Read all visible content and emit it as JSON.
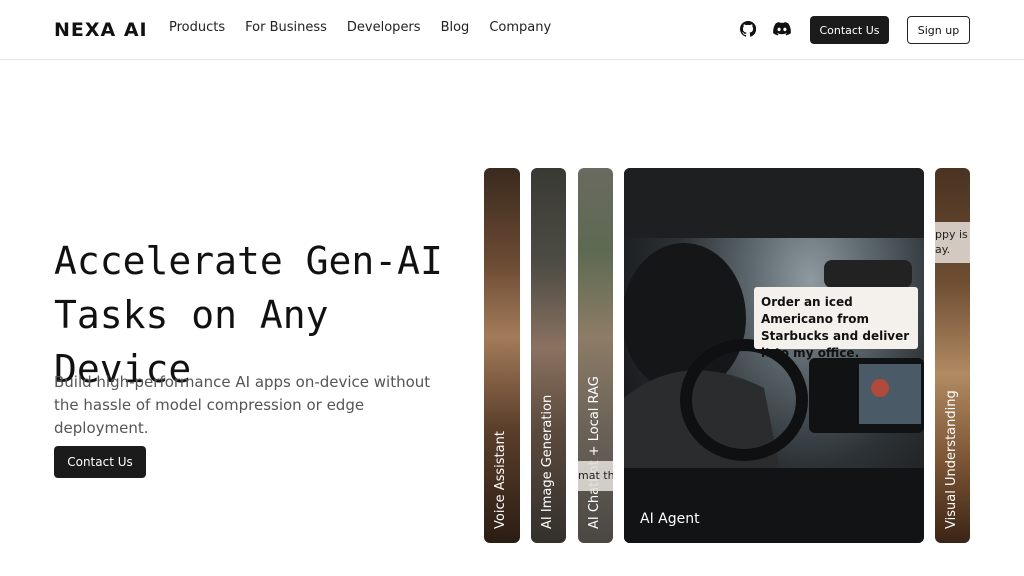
{
  "header": {
    "logo_text": "NEXA AI",
    "nav": [
      "Products",
      "For Business",
      "Developers",
      "Blog",
      "Company"
    ],
    "icons": [
      "github-icon",
      "discord-icon"
    ],
    "contact_label": "Contact Us",
    "signup_label": "Sign up"
  },
  "hero": {
    "title_line1": "Accelerate Gen-AI",
    "title_line2": "Tasks on Any Device",
    "subtitle": "Build high-performance AI apps on-device without the hassle of model compression or edge deployment.",
    "cta_label": "Contact Us"
  },
  "cards": {
    "voice": "Voice Assistant",
    "image_gen": "AI Image Generation",
    "rag": "AI Chatbot + Local RAG",
    "agent": "AI Agent",
    "visual": "Visual Understanding",
    "agent_bubble": "Order an iced Americano from Starbucks and deliver it to my office.",
    "peek_right": "ppy is\nay.",
    "peek_mid": "mat th"
  },
  "colors": {
    "primary_button": "#1b1b1b",
    "text": "#111111",
    "muted_text": "#555555"
  }
}
